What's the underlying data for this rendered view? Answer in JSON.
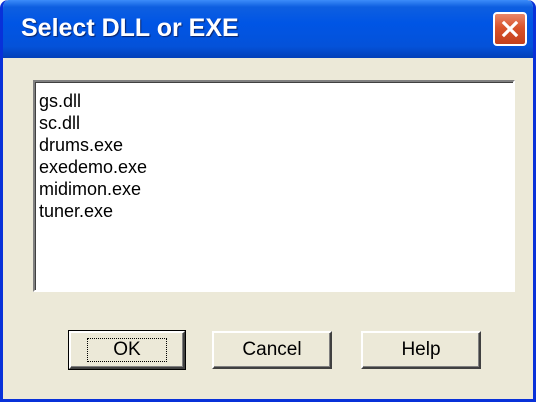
{
  "window": {
    "title": "Select DLL or EXE"
  },
  "list": {
    "items": [
      "gs.dll",
      "sc.dll",
      "drums.exe",
      "exedemo.exe",
      "midimon.exe",
      "tuner.exe"
    ]
  },
  "buttons": {
    "ok_label": "OK",
    "cancel_label": "Cancel",
    "help_label": "Help"
  },
  "colors": {
    "titlebar": "#0055e5",
    "close_button": "#d9532b",
    "dialog_face": "#ece9d8"
  },
  "icons": {
    "close": "close-icon"
  }
}
